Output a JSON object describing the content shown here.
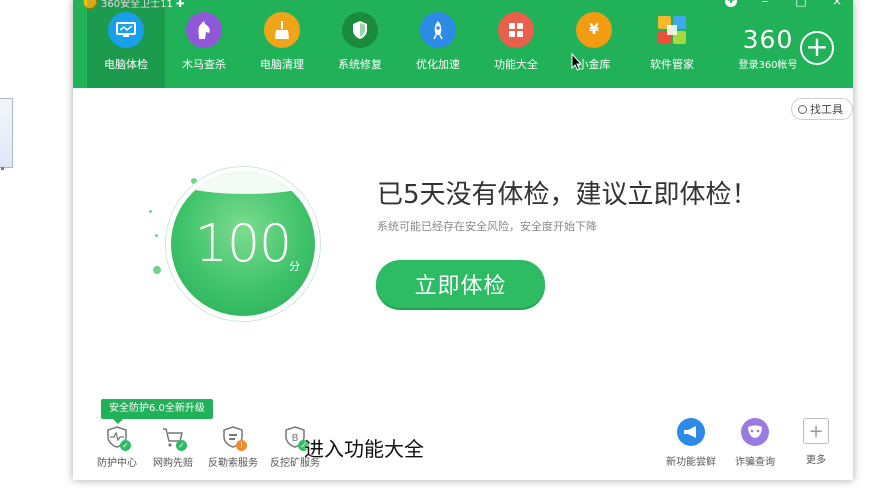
{
  "window": {
    "title": "360安全卫士11 ✚",
    "controls": [
      "✚",
      "–",
      "□",
      "×"
    ]
  },
  "nav": {
    "items": [
      {
        "label": "电脑体检",
        "icon": "monitor-icon",
        "color": "#1aa0e8",
        "active": true
      },
      {
        "label": "木马查杀",
        "icon": "horse-icon",
        "color": "#8e58d8",
        "active": false
      },
      {
        "label": "电脑清理",
        "icon": "broom-icon",
        "color": "#f0a419",
        "active": false
      },
      {
        "label": "系统修复",
        "icon": "shield-icon",
        "color": "#1a8b3c",
        "active": false
      },
      {
        "label": "优化加速",
        "icon": "rocket-icon",
        "color": "#2d8ae6",
        "active": false
      },
      {
        "label": "功能大全",
        "icon": "grid-icon",
        "color": "#e8604c",
        "active": false
      },
      {
        "label": "小金库",
        "icon": "money-bag-icon",
        "color": "#f39c12",
        "active": false
      },
      {
        "label": "软件管家",
        "icon": "apps-icon",
        "color": "#f4f4f4",
        "active": false
      }
    ]
  },
  "account": {
    "logo_text": "360",
    "login_label": "登录360帐号",
    "add_icon": "plus-circle-icon"
  },
  "find_tools": {
    "label": "找工具"
  },
  "score": {
    "value": "100",
    "unit": "分"
  },
  "main": {
    "headline": "已5天没有体检，建议立即体检！",
    "subline": "系统可能已经存在安全风险，安全度开始下降",
    "check_button": "立即体检"
  },
  "protection": {
    "badge": "安全防护6.0全新升级",
    "items": [
      {
        "label": "防护中心",
        "icon": "pulse-shield-icon"
      },
      {
        "label": "网购先赔",
        "icon": "cart-icon"
      },
      {
        "label": "反勒索服务",
        "icon": "lock-doc-icon"
      },
      {
        "label": "反挖矿服务",
        "icon": "mining-shield-icon"
      }
    ]
  },
  "caption": "进入功能大全",
  "tools": [
    {
      "label": "新功能尝鲜",
      "icon": "megaphone-icon",
      "color": "#2d8ae6"
    },
    {
      "label": "诈骗查询",
      "icon": "mask-icon",
      "color": "#9c7be0"
    },
    {
      "label": "更多",
      "icon": "more-plus-icon",
      "color": ""
    }
  ]
}
